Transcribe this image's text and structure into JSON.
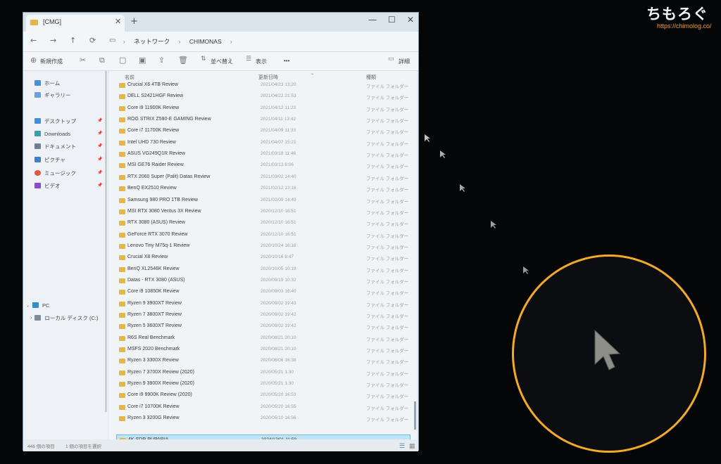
{
  "watermark": {
    "title": "ちもろぐ",
    "url": "https://chimolog.co/"
  },
  "window": {
    "tab_title": "[CMG]",
    "breadcrumbs": [
      "ネットワーク",
      "CHIMONAS"
    ],
    "toolbar": {
      "new": "新規作成",
      "sort": "並べ替え",
      "view": "表示",
      "more": "•••",
      "details": "詳細"
    },
    "nav_pane": {
      "quick": [
        {
          "label": "ホーム",
          "icon": "home-icon",
          "color": "#4a90d9"
        },
        {
          "label": "ギャラリー",
          "icon": "gallery-icon",
          "color": "#6aa0e0"
        }
      ],
      "pinned": [
        {
          "label": "デスクトップ",
          "icon": "desktop-icon",
          "color": "#3f8fd8"
        },
        {
          "label": "Downloads",
          "icon": "download-icon",
          "color": "#3aa0a8"
        },
        {
          "label": "ドキュメント",
          "icon": "document-icon",
          "color": "#6d7f96"
        },
        {
          "label": "ピクチャ",
          "icon": "picture-icon",
          "color": "#3a7fd0"
        },
        {
          "label": "ミュージック",
          "icon": "music-icon",
          "color": "#e2563a"
        },
        {
          "label": "ビデオ",
          "icon": "video-icon",
          "color": "#8a4ad0"
        }
      ],
      "pc": "PC",
      "drive": "ローカル ディスク (C:)"
    },
    "columns": {
      "name": "名前",
      "date": "更新日時",
      "type": "種類"
    },
    "files": [
      {
        "name": "Crucial X6 4TB Review",
        "date": "2021/04/23 13:20",
        "type": "ファイル フォルダー"
      },
      {
        "name": "DELL S2421HGF Review",
        "date": "2021/04/22 21:53",
        "type": "ファイル フォルダー"
      },
      {
        "name": "Core i9 11900K Review",
        "date": "2021/04/12 11:23",
        "type": "ファイル フォルダー"
      },
      {
        "name": "ROG STRIX Z590-E GAMING Review",
        "date": "2021/04/11 13:42",
        "type": "ファイル フォルダー"
      },
      {
        "name": "Core i7 11700K Review",
        "date": "2021/04/09 11:33",
        "type": "ファイル フォルダー"
      },
      {
        "name": "Intel UHD 730 Review",
        "date": "2021/04/07 15:21",
        "type": "ファイル フォルダー"
      },
      {
        "name": "ASUS VG249Q1R Review",
        "date": "2021/03/18 11:46",
        "type": "ファイル フォルダー"
      },
      {
        "name": "MSI GE76 Raider Review",
        "date": "2021/03/12 8:06",
        "type": "ファイル フォルダー"
      },
      {
        "name": "RTX 2060 Super (Palit) Datas Review",
        "date": "2021/03/02 14:40",
        "type": "ファイル フォルダー"
      },
      {
        "name": "BenQ EX2510 Review",
        "date": "2021/02/12 13:16",
        "type": "ファイル フォルダー"
      },
      {
        "name": "Samsung 980 PRO 1TB Review",
        "date": "2021/02/09 14:49",
        "type": "ファイル フォルダー"
      },
      {
        "name": "MSI RTX 3080 Ventus 3X Review",
        "date": "2020/12/10 16:51",
        "type": "ファイル フォルダー"
      },
      {
        "name": "RTX 3080 (ASUS) Review",
        "date": "2020/12/10 16:51",
        "type": "ファイル フォルダー"
      },
      {
        "name": "GeForce RTX 3070 Review",
        "date": "2020/12/10 16:51",
        "type": "ファイル フォルダー"
      },
      {
        "name": "Lenovo Tiny M75q-1 Review",
        "date": "2020/10/24 16:16",
        "type": "ファイル フォルダー"
      },
      {
        "name": "Crucial X8 Review",
        "date": "2020/10/16 9:47",
        "type": "ファイル フォルダー"
      },
      {
        "name": "BenQ XL2546K Review",
        "date": "2020/10/05 10:19",
        "type": "ファイル フォルダー"
      },
      {
        "name": "Datas - RTX 3080 (ASUS)",
        "date": "2020/09/19 10:32",
        "type": "ファイル フォルダー"
      },
      {
        "name": "Core i9 10850K Review",
        "date": "2020/09/03 16:40",
        "type": "ファイル フォルダー"
      },
      {
        "name": "Ryzen 9 3900XT Review",
        "date": "2020/09/02 19:43",
        "type": "ファイル フォルダー"
      },
      {
        "name": "Ryzen 7 3800XT Review",
        "date": "2020/09/02 19:42",
        "type": "ファイル フォルダー"
      },
      {
        "name": "Ryzen 5 3600XT Review",
        "date": "2020/09/02 19:42",
        "type": "ファイル フォルダー"
      },
      {
        "name": "R6S Real Benchmark",
        "date": "2020/08/21 20:10",
        "type": "ファイル フォルダー"
      },
      {
        "name": "MSFS 2020 Benchmark",
        "date": "2020/08/21 20:10",
        "type": "ファイル フォルダー"
      },
      {
        "name": "Ryzen 3 3300X Review",
        "date": "2020/06/06 16:38",
        "type": "ファイル フォルダー"
      },
      {
        "name": "Ryzen 7 3700X Review (2020)",
        "date": "2020/05/21 1:30",
        "type": "ファイル フォルダー"
      },
      {
        "name": "Ryzen 9 3900X Review (2020)",
        "date": "2020/05/21 1:30",
        "type": "ファイル フォルダー"
      },
      {
        "name": "Core i9 9900K Review (2020)",
        "date": "2020/05/20 16:53",
        "type": "ファイル フォルダー"
      },
      {
        "name": "Core i7 10700K Review",
        "date": "2020/05/20 16:55",
        "type": "ファイル フォルダー"
      },
      {
        "name": "Ryzen 3 3200G Review",
        "date": "2020/05/10 16:56",
        "type": "ファイル フォルダー"
      },
      {
        "name": "4K SDR PUPARIA",
        "date": "2024/12/01 11:59",
        "type": "ファイル フォルダー",
        "selected": true
      }
    ],
    "status": {
      "count": "446 個の項目",
      "selected": "1 個の項目を選択"
    }
  }
}
